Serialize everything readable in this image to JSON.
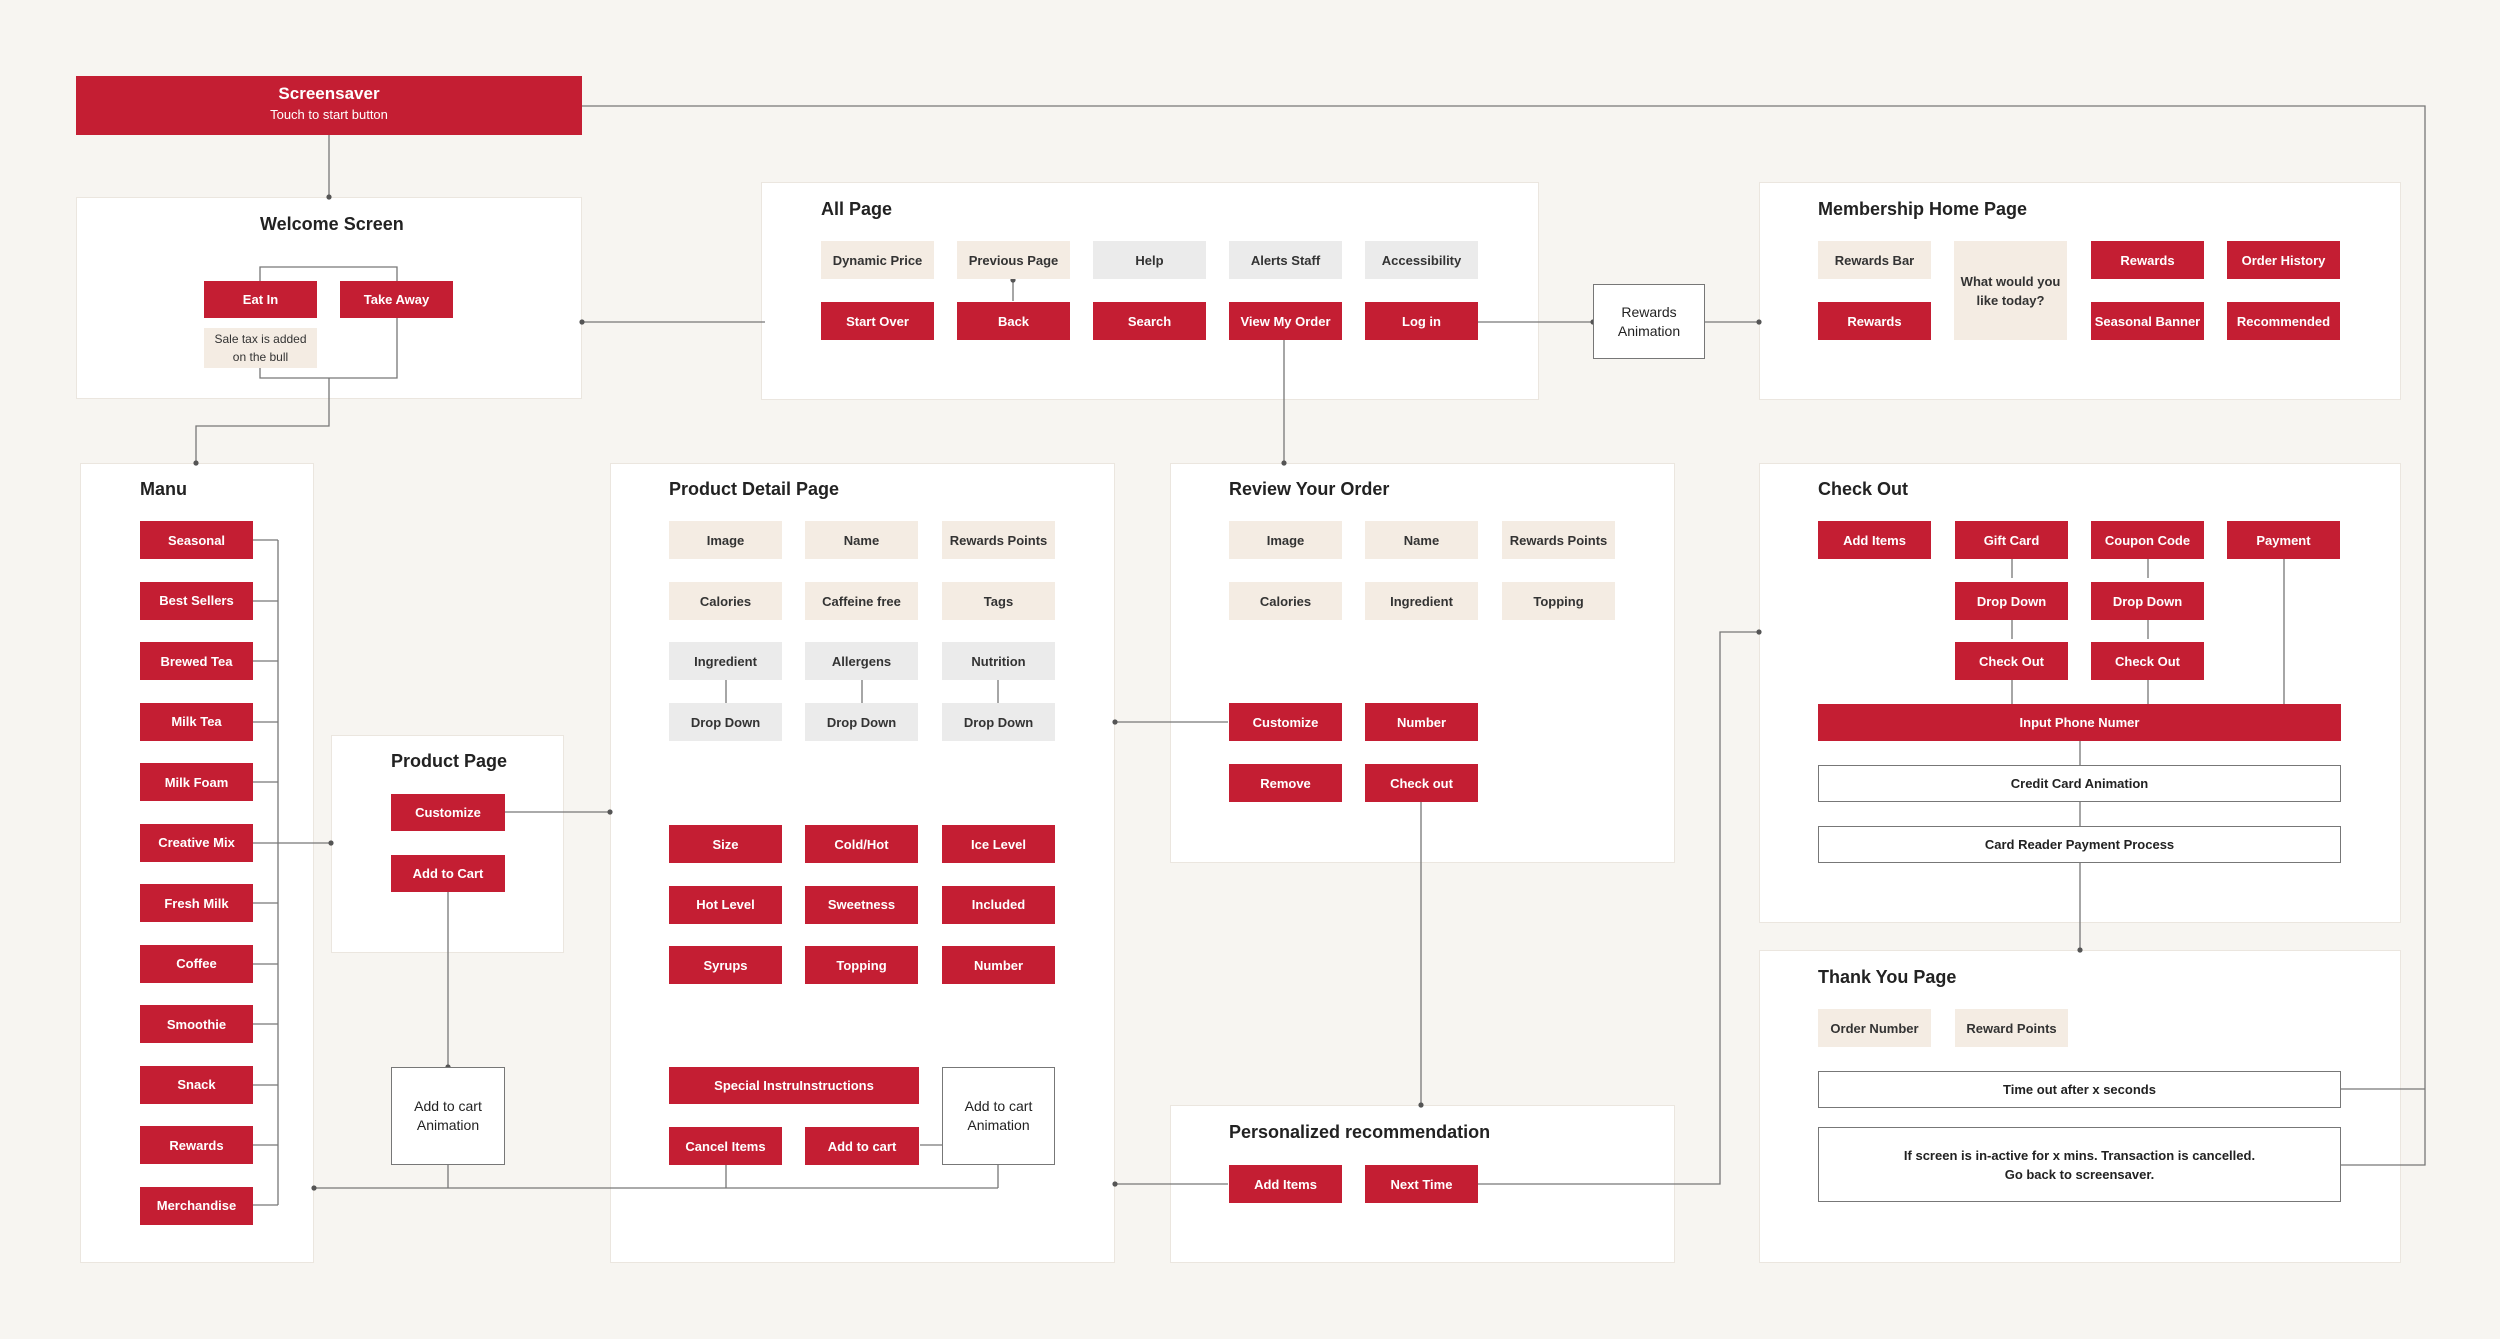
{
  "screensaver": {
    "title": "Screensaver",
    "subtitle": "Touch to start button"
  },
  "welcome": {
    "title": "Welcome Screen",
    "eat_in": "Eat In",
    "take_away": "Take Away",
    "tax_note": "Sale tax is added on the bull"
  },
  "all_page": {
    "title": "All Page",
    "row1": [
      "Dynamic Price",
      "Previous Page",
      "Help",
      "Alerts Staff",
      "Accessibility"
    ],
    "row2": [
      "Start Over",
      "Back",
      "Search",
      "View My Order",
      "Log in"
    ]
  },
  "rewards_animation": "Rewards Animation",
  "membership": {
    "title": "Membership Home Page",
    "rewards_bar": "Rewards Bar",
    "rewards_btn": "Rewards",
    "question": "What would you like today?",
    "rewards_tile": "Rewards",
    "order_history": "Order History",
    "seasonal_banner": "Seasonal Banner",
    "recommended": "Recommended"
  },
  "menu": {
    "title": "Manu",
    "items": [
      "Seasonal",
      "Best Sellers",
      "Brewed Tea",
      "Milk Tea",
      "Milk Foam",
      "Creative Mix",
      "Fresh Milk",
      "Coffee",
      "Smoothie",
      "Snack",
      "Rewards",
      "Merchandise"
    ]
  },
  "product_page": {
    "title": "Product Page",
    "customize": "Customize",
    "add_to_cart": "Add to Cart",
    "animation": "Add to cart Animation"
  },
  "product_detail": {
    "title": "Product Detail Page",
    "info": [
      "Image",
      "Name",
      "Rewards Points",
      "Calories",
      "Caffeine free",
      "Tags"
    ],
    "grey": [
      "Ingredient",
      "Allergens",
      "Nutrition"
    ],
    "dropdowns": [
      "Drop Down",
      "Drop Down",
      "Drop Down"
    ],
    "options": [
      "Size",
      "Cold/Hot",
      "Ice Level",
      "Hot Level",
      "Sweetness",
      "Included",
      "Syrups",
      "Topping",
      "Number"
    ],
    "special": "Special InstruInstructions",
    "cancel": "Cancel Items",
    "add_to_cart": "Add to cart",
    "animation": "Add to cart Animation"
  },
  "review": {
    "title": "Review Your Order",
    "info": [
      "Image",
      "Name",
      "Rewards Points",
      "Calories",
      "Ingredient",
      "Topping"
    ],
    "customize": "Customize",
    "number": "Number",
    "remove": "Remove",
    "checkout": "Check out"
  },
  "personalized": {
    "title": "Personalized recommendation",
    "add_items": "Add Items",
    "next_time": "Next Time"
  },
  "checkout": {
    "title": "Check Out",
    "add_items": "Add Items",
    "gift_card": "Gift Card",
    "coupon_code": "Coupon Code",
    "payment": "Payment",
    "drop_down_1": "Drop Down",
    "drop_down_2": "Drop Down",
    "check_out_1": "Check Out",
    "check_out_2": "Check Out",
    "phone": "Input Phone Numer",
    "credit_anim": "Credit Card Animation",
    "card_reader": "Card Reader Payment Process"
  },
  "thankyou": {
    "title": "Thank You Page",
    "order_number": "Order Number",
    "reward_points": "Reward Points",
    "timeout": "Time out after x seconds",
    "inactive_1": "If screen is in-active for x mins. Transaction is cancelled.",
    "inactive_2": "Go back to screensaver."
  },
  "colors": {
    "accent_red": "#c41e33",
    "beige": "#f4ece3",
    "grey": "#ebebeb",
    "background": "#f7f5f1",
    "line": "#666666"
  }
}
